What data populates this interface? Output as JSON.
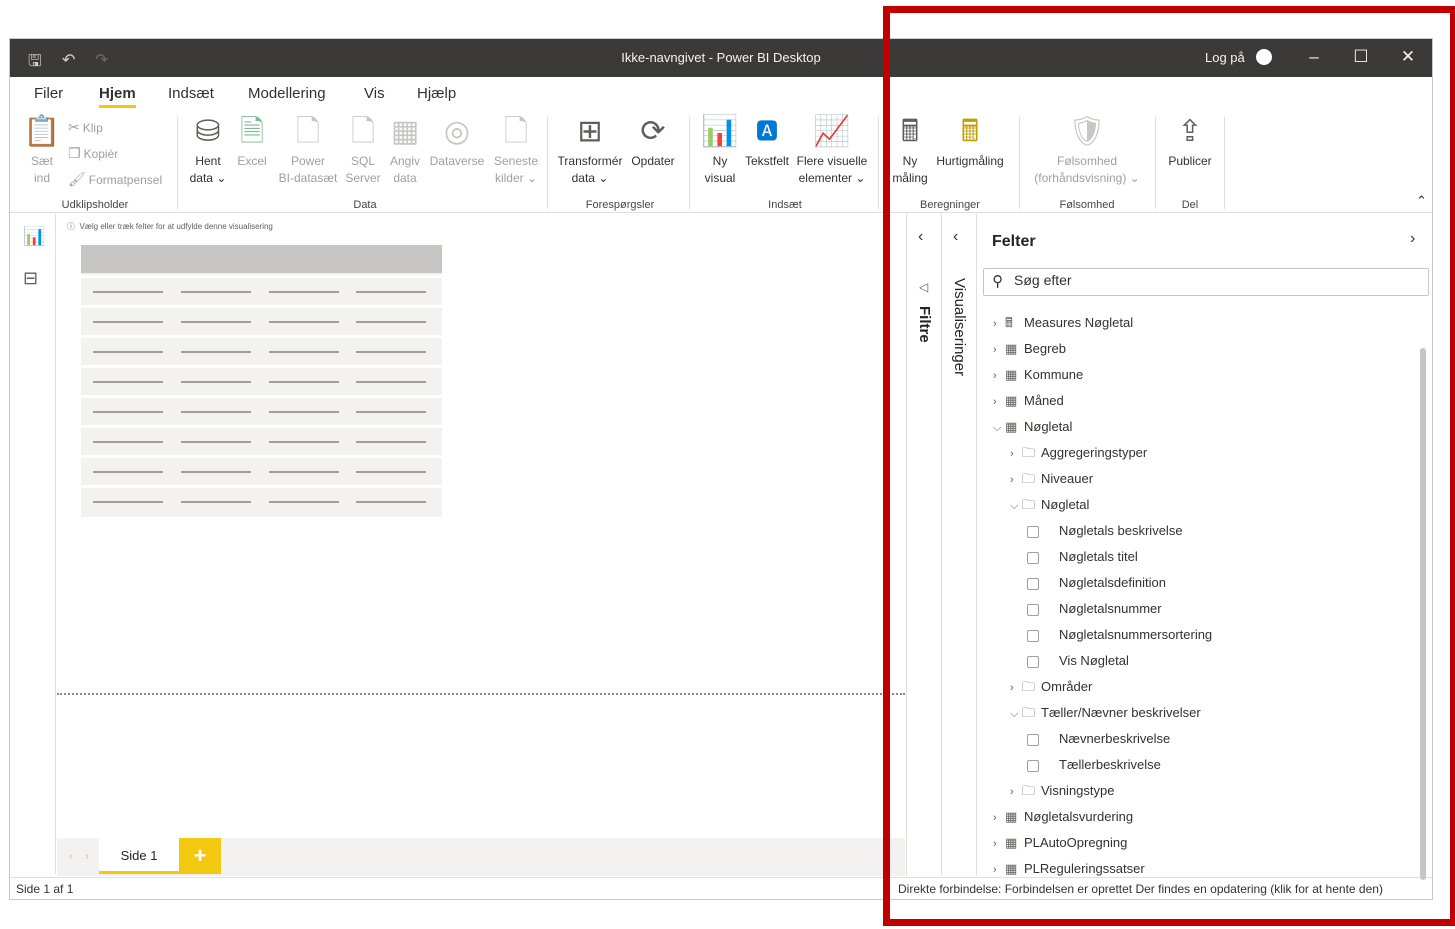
{
  "titlebar": {
    "title": "Ikke-navngivet - Power BI Desktop",
    "login": "Log på"
  },
  "menu": [
    "Filer",
    "Hjem",
    "Indsæt",
    "Modellering",
    "Vis",
    "Hjælp"
  ],
  "ribbon": {
    "clipboard": {
      "paste": [
        "Sæt",
        "ind"
      ],
      "cut": "Klip",
      "copy": "Kopiér",
      "format_painter": "Formatpensel",
      "group": "Udklipsholder"
    },
    "data": {
      "get_data": [
        "Hent",
        "data ⌄"
      ],
      "excel": "Excel",
      "powerbi": [
        "Power",
        "BI-datasæt"
      ],
      "sql": [
        "SQL",
        "Server"
      ],
      "enter": [
        "Angiv",
        "data"
      ],
      "dataverse": "Dataverse",
      "recent": [
        "Seneste",
        "kilder ⌄"
      ],
      "group": "Data"
    },
    "queries": {
      "transform": [
        "Transformér",
        "data ⌄"
      ],
      "refresh": "Opdater",
      "group": "Forespørgsler"
    },
    "insert": {
      "new_visual": [
        "Ny",
        "visual"
      ],
      "textbox": "Tekstfelt",
      "more_visuals": [
        "Flere visuelle",
        "elementer ⌄"
      ],
      "group": "Indsæt"
    },
    "calc": {
      "new_measure": [
        "Ny",
        "måling"
      ],
      "quick_measure": "Hurtigmåling",
      "group": "Beregninger"
    },
    "sensitivity": {
      "label": [
        "Følsomhed",
        "(forhåndsvisning) ⌄"
      ],
      "group": "Følsomhed"
    },
    "share": {
      "publish": "Publicer",
      "group": "Del"
    }
  },
  "canvas": {
    "hint": "Vælg eller træk felter for at udfylde denne visualisering"
  },
  "pages": {
    "tab": "Side 1",
    "add": "+"
  },
  "status": {
    "left": "Side 1 af 1",
    "right": "Direkte forbindelse: Forbindelsen er oprettet  Der findes en opdatering (klik for at hente den)"
  },
  "panes": {
    "filters": "Filtre",
    "visualizations": "Visualiseringer",
    "fields_title": "Felter",
    "search_placeholder": "Søg efter"
  },
  "fields": [
    {
      "label": "Measures Nøgletal",
      "level": 0,
      "kind": "measure",
      "chev": ">"
    },
    {
      "label": "Begreb",
      "level": 0,
      "kind": "table",
      "chev": ">"
    },
    {
      "label": "Kommune",
      "level": 0,
      "kind": "table",
      "chev": ">"
    },
    {
      "label": "Måned",
      "level": 0,
      "kind": "table",
      "chev": ">"
    },
    {
      "label": "Nøgletal",
      "level": 0,
      "kind": "table",
      "chev": "v"
    },
    {
      "label": "Aggregeringstyper",
      "level": 1,
      "kind": "folder",
      "chev": ">"
    },
    {
      "label": "Niveauer",
      "level": 1,
      "kind": "folder",
      "chev": ">"
    },
    {
      "label": "Nøgletal",
      "level": 1,
      "kind": "folder",
      "chev": "v"
    },
    {
      "label": "Nøgletals beskrivelse",
      "level": 2,
      "kind": "field"
    },
    {
      "label": "Nøgletals titel",
      "level": 2,
      "kind": "field"
    },
    {
      "label": "Nøgletalsdefinition",
      "level": 2,
      "kind": "field"
    },
    {
      "label": "Nøgletalsnummer",
      "level": 2,
      "kind": "field"
    },
    {
      "label": "Nøgletalsnummersortering",
      "level": 2,
      "kind": "field"
    },
    {
      "label": "Vis Nøgletal",
      "level": 2,
      "kind": "field"
    },
    {
      "label": "Områder",
      "level": 1,
      "kind": "folder",
      "chev": ">"
    },
    {
      "label": "Tæller/Nævner beskrivelser",
      "level": 1,
      "kind": "folder",
      "chev": "v"
    },
    {
      "label": "Nævnerbeskrivelse",
      "level": 2,
      "kind": "field"
    },
    {
      "label": "Tællerbeskrivelse",
      "level": 2,
      "kind": "field"
    },
    {
      "label": "Visningstype",
      "level": 1,
      "kind": "folder",
      "chev": ">"
    },
    {
      "label": "Nøgletalsvurdering",
      "level": 0,
      "kind": "table",
      "chev": ">"
    },
    {
      "label": "PLAutoOpregning",
      "level": 0,
      "kind": "table",
      "chev": ">"
    },
    {
      "label": "PLReguleringssatser",
      "level": 0,
      "kind": "table",
      "chev": ">"
    }
  ],
  "colors": {
    "accent": "#f2c811",
    "highlight": "#c00000",
    "titlebar": "#3b3a39"
  }
}
